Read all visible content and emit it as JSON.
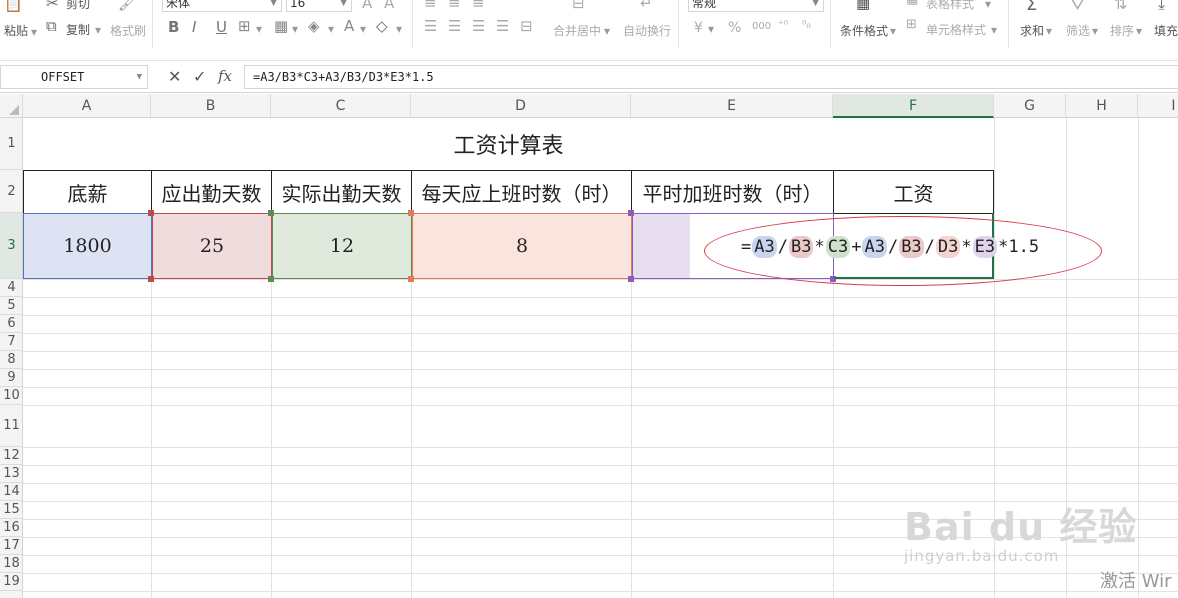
{
  "ribbon": {
    "cut": "剪切",
    "paste": "粘贴",
    "copy": "复制",
    "format_painter": "格式刷",
    "font_name": "宋体",
    "font_size": "16",
    "bold": "B",
    "italic": "I",
    "underline": "U",
    "merge_center": "合并居中",
    "wrap_text": "自动换行",
    "number_format": "常规",
    "currency": "¥",
    "percent": "%",
    "thousands": "000",
    "table_style": "表格样式",
    "conditional_format": "条件格式",
    "cell_style": "单元格样式",
    "sum": "求和",
    "filter": "筛选",
    "sort": "排序",
    "fill": "填充"
  },
  "formula_bar": {
    "name_box": "OFFSET",
    "fx": "fx",
    "formula": "=A3/B3*C3+A3/B3/D3*E3*1.5"
  },
  "columns": [
    "A",
    "B",
    "C",
    "D",
    "E",
    "F",
    "G",
    "H",
    "I"
  ],
  "rows": [
    "1",
    "2",
    "3",
    "4",
    "5",
    "6",
    "7",
    "8",
    "9",
    "10",
    "11",
    "12",
    "13",
    "14",
    "15",
    "16",
    "17",
    "18",
    "19"
  ],
  "sheet": {
    "title": "工资计算表",
    "headers": [
      "底薪",
      "应出勤天数",
      "实际出勤天数",
      "每天应上班时数（时）",
      "平时加班时数（时）",
      "工资"
    ],
    "values": [
      "1800",
      "25",
      "12",
      "8",
      ""
    ],
    "formula_tokens": [
      {
        "t": "=",
        "kind": "op"
      },
      {
        "t": "A3",
        "kind": "ref",
        "color": "#c9d5ee"
      },
      {
        "t": "/",
        "kind": "op"
      },
      {
        "t": "B3",
        "kind": "ref",
        "color": "#ecc9c9"
      },
      {
        "t": "*",
        "kind": "op"
      },
      {
        "t": "C3",
        "kind": "ref",
        "color": "#cfe0cd"
      },
      {
        "t": "+",
        "kind": "op"
      },
      {
        "t": "A3",
        "kind": "ref",
        "color": "#c9d5ee"
      },
      {
        "t": "/",
        "kind": "op"
      },
      {
        "t": "B3",
        "kind": "ref",
        "color": "#ecc9c9"
      },
      {
        "t": "/",
        "kind": "op"
      },
      {
        "t": "D3",
        "kind": "ref",
        "color": "#f3d4cf"
      },
      {
        "t": "*",
        "kind": "op"
      },
      {
        "t": "E3",
        "kind": "ref",
        "color": "#e0d3ec"
      },
      {
        "t": "*1.5",
        "kind": "op"
      }
    ]
  },
  "watermark": {
    "brand": "Bai du 经验",
    "url": "jingyan.baidu.com"
  },
  "activate_text": "激活 Wir",
  "colors": {
    "a3": "#dee3f3",
    "b3": "#f0dcdc",
    "c3": "#dfe9dc",
    "d3": "#fbe3de",
    "e3": "#e7dff0",
    "a3_border": "#4f74c0",
    "b3_border": "#b84b4b",
    "c3_border": "#5f8a55",
    "d3_border": "#e07a5a",
    "e3_border": "#8a5cc0",
    "selection": "#217346",
    "ellipse": "#d9394a"
  }
}
